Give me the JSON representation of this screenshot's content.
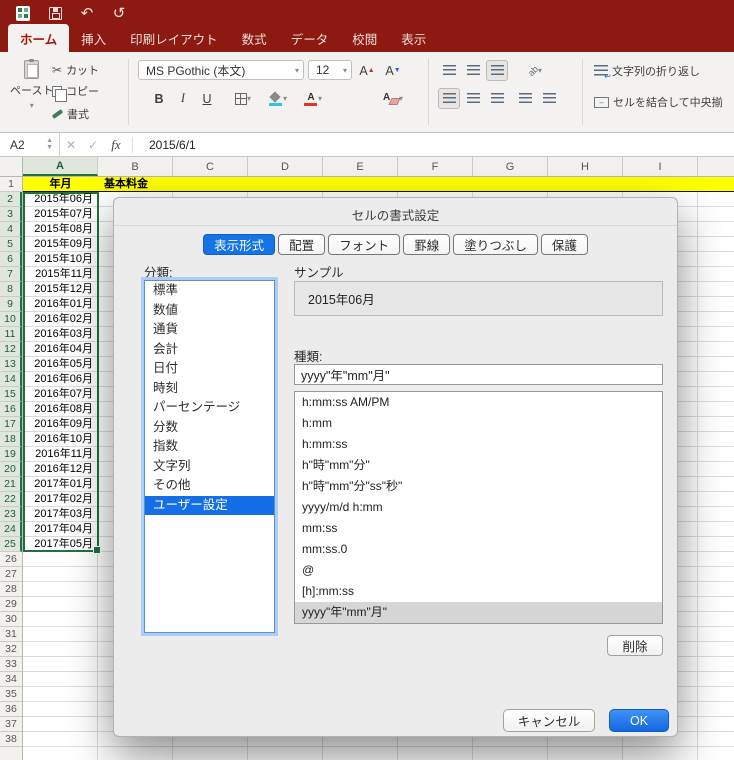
{
  "titlebar": {
    "icons": [
      "excel-doc",
      "save",
      "undo",
      "redo"
    ],
    "undo_glyph": "↶",
    "redo_glyph": "↺"
  },
  "ribbon_tabs": [
    {
      "label": "ホーム",
      "active": true
    },
    {
      "label": "挿入",
      "active": false
    },
    {
      "label": "印刷レイアウト",
      "active": false
    },
    {
      "label": "数式",
      "active": false
    },
    {
      "label": "データ",
      "active": false
    },
    {
      "label": "校閲",
      "active": false
    },
    {
      "label": "表示",
      "active": false
    }
  ],
  "ribbon": {
    "paste_label": "ペースト",
    "cut_label": "カット",
    "copy_label": "コピー",
    "format_label": "書式",
    "font_name": "MS PGothic (本文)",
    "font_size": "12",
    "bold_label": "B",
    "italic_label": "I",
    "underline_label": "U",
    "grow_font_label": "A",
    "shrink_font_label": "A",
    "clear_letter": "A",
    "orientation_label": "ab",
    "wrap_label": "文字列の折り返し",
    "merge_label": "セルを結合して中央揃"
  },
  "formula_bar": {
    "cell_ref": "A2",
    "cancel_glyph": "✕",
    "enter_glyph": "✓",
    "fx_label": "fx",
    "value": "2015/6/1"
  },
  "sheet": {
    "columns": [
      "A",
      "B",
      "C",
      "D",
      "E",
      "F",
      "G",
      "H",
      "I"
    ],
    "row_count": 38,
    "selected_column": "A",
    "selected_row_start": 2,
    "selected_row_end": 25,
    "header_row": {
      "a1": "年月",
      "b1": "基本料金"
    },
    "dates": [
      "2015年06月",
      "2015年07月",
      "2015年08月",
      "2015年09月",
      "2015年10月",
      "2015年11月",
      "2015年12月",
      "2016年01月",
      "2016年02月",
      "2016年03月",
      "2016年04月",
      "2016年05月",
      "2016年06月",
      "2016年07月",
      "2016年08月",
      "2016年09月",
      "2016年10月",
      "2016年11月",
      "2016年12月",
      "2017年01月",
      "2017年02月",
      "2017年03月",
      "2017年04月",
      "2017年05月"
    ]
  },
  "dialog": {
    "title": "セルの書式設定",
    "tabs": [
      {
        "label": "表示形式",
        "active": true
      },
      {
        "label": "配置",
        "active": false
      },
      {
        "label": "フォント",
        "active": false
      },
      {
        "label": "罫線",
        "active": false
      },
      {
        "label": "塗りつぶし",
        "active": false
      },
      {
        "label": "保護",
        "active": false
      }
    ],
    "category_label": "分類:",
    "categories": [
      "標準",
      "数値",
      "通貨",
      "会計",
      "日付",
      "時刻",
      "パーセンテージ",
      "分数",
      "指数",
      "文字列",
      "その他",
      "ユーザー設定"
    ],
    "selected_category": "ユーザー設定",
    "sample_label": "サンプル",
    "sample_value": "2015年06月",
    "type_label": "種類:",
    "type_value": "yyyy\"年\"mm\"月\"",
    "format_list": [
      "h:mm:ss AM/PM",
      "h:mm",
      "h:mm:ss",
      "h\"時\"mm\"分\"",
      "h\"時\"mm\"分\"ss\"秒\"",
      "yyyy/m/d h:mm",
      "mm:ss",
      "mm:ss.0",
      "@",
      "[h]:mm:ss",
      "yyyy\"年\"mm\"月\""
    ],
    "selected_format": "yyyy\"年\"mm\"月\"",
    "delete_button": "削除",
    "cancel_button": "キャンセル",
    "ok_button": "OK"
  },
  "colors": {
    "titlebar": "#8c1a10",
    "accent_blue": "#1673e6",
    "selection_green": "#1e7145",
    "header_yellow": "#ffff00"
  }
}
